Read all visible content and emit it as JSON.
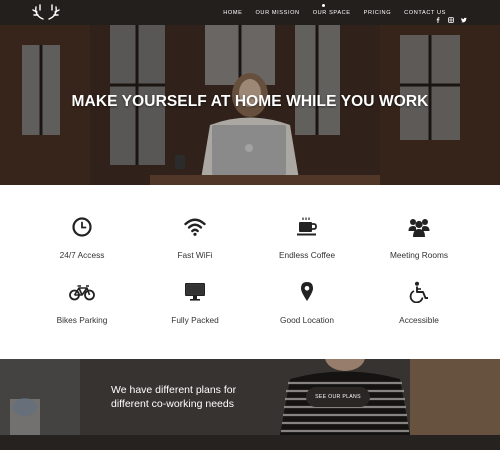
{
  "nav": {
    "menu": [
      {
        "label": "HOME"
      },
      {
        "label": "OUR MISSION"
      },
      {
        "label": "OUR SPACE"
      },
      {
        "label": "PRICING"
      },
      {
        "label": "CONTACT US"
      }
    ],
    "social": [
      "facebook-icon",
      "instagram-icon",
      "twitter-icon"
    ]
  },
  "hero": {
    "title": "MAKE YOURSELF AT HOME WHILE YOU WORK"
  },
  "features": [
    {
      "label": "24/7 Access",
      "icon": "clock-icon"
    },
    {
      "label": "Fast WiFi",
      "icon": "wifi-icon"
    },
    {
      "label": "Endless Coffee",
      "icon": "coffee-cup-icon"
    },
    {
      "label": "Meeting Rooms",
      "icon": "group-icon"
    },
    {
      "label": "Bikes Parking",
      "icon": "bicycle-icon"
    },
    {
      "label": "Fully Packed",
      "icon": "monitor-icon"
    },
    {
      "label": "Good Location",
      "icon": "map-marker-icon"
    },
    {
      "label": "Accessible",
      "icon": "wheelchair-icon"
    }
  ],
  "cta": {
    "line1": "We have different plans for",
    "line2": "different co-working needs",
    "button": "SEE OUR PLANS"
  },
  "colors": {
    "nav_bg": "#231f1c",
    "icon": "#222222",
    "button_bg": "#2a2624"
  }
}
